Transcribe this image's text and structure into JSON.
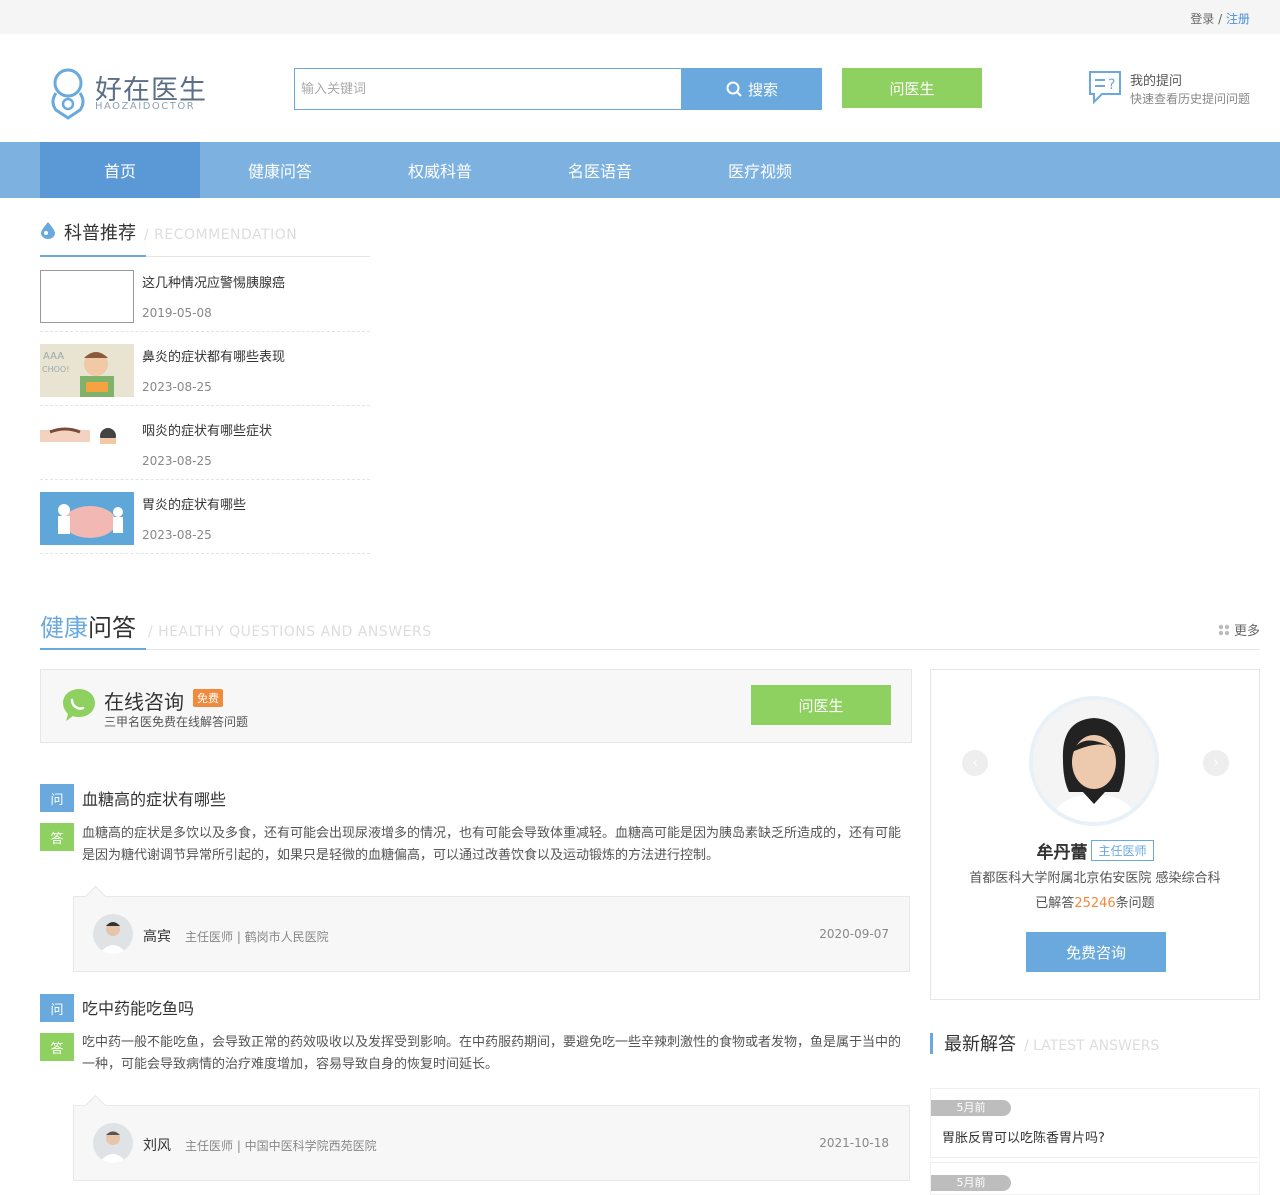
{
  "topbar": {
    "login": "登录",
    "sep": " / ",
    "register": "注册"
  },
  "logo": {
    "name": "好在医生",
    "sub": "HAOZAIDOCTOR"
  },
  "search": {
    "placeholder": "输入关键词",
    "button": "搜索"
  },
  "ask_button": "问医生",
  "my_questions": {
    "title": "我的提问",
    "desc": "快速查看历史提问问题"
  },
  "nav": [
    {
      "label": "首页",
      "active": true
    },
    {
      "label": "健康问答"
    },
    {
      "label": "权威科普"
    },
    {
      "label": "名医语音"
    },
    {
      "label": "医疗视频"
    }
  ],
  "recommend": {
    "title": "科普推荐",
    "en": "/ RECOMMENDATION",
    "items": [
      {
        "title": "这几种情况应警惕胰腺癌",
        "date": "2019-05-08"
      },
      {
        "title": "鼻炎的症状都有哪些表现",
        "date": "2023-08-25"
      },
      {
        "title": "咽炎的症状有哪些症状",
        "date": "2023-08-25"
      },
      {
        "title": "胃炎的症状有哪些",
        "date": "2023-08-25"
      }
    ]
  },
  "qa": {
    "title_a": "健康",
    "title_b": "问答",
    "en": "/ HEALTHY QUESTIONS AND ANSWERS",
    "more": "更多",
    "consult": {
      "title": "在线咨询",
      "badge": "免费",
      "desc": "三甲名医免费在线解答问题",
      "button": "问医生"
    },
    "q_tag": "问",
    "a_tag": "答",
    "items": [
      {
        "question": "血糖高的症状有哪些",
        "answer": "血糖高的症状是多饮以及多食，还有可能会出现尿液增多的情况，也有可能会导致体重减轻。血糖高可能是因为胰岛素缺乏所造成的，还有可能是因为糖代谢调节异常所引起的，如果只是轻微的血糖偏高，可以通过改善饮食以及运动锻炼的方法进行控制。",
        "doctor": "高宾",
        "info": "主任医师 | 鹤岗市人民医院",
        "date": "2020-09-07"
      },
      {
        "question": "吃中药能吃鱼吗",
        "answer": "吃中药一般不能吃鱼，会导致正常的药效吸收以及发挥受到影响。在中药服药期间，要避免吃一些辛辣刺激性的食物或者发物，鱼是属于当中的一种，可能会导致病情的治疗难度增加，容易导致自身的恢复时间延长。",
        "doctor": "刘风",
        "info": "主任医师 | 中国中医科学院西苑医院",
        "date": "2021-10-18"
      }
    ]
  },
  "featured_doctor": {
    "name": "牟丹蕾",
    "title": "主任医师",
    "hospital": "首都医科大学附属北京佑安医院 感染综合科",
    "answered_prefix": "已解答",
    "answered_count": "25246",
    "answered_suffix": "条问题",
    "button": "免费咨询"
  },
  "latest": {
    "title": "最新解答",
    "en": "/ LATEST ANSWERS",
    "items": [
      {
        "ago": "5月前",
        "title": "胃胀反胃可以吃陈香胃片吗?"
      },
      {
        "ago": "5月前",
        "title": ""
      }
    ]
  },
  "colors": {
    "primary": "#6aa9dd",
    "green": "#8fd160",
    "nav": "#7cb1e0",
    "orange": "#f08a3c"
  }
}
